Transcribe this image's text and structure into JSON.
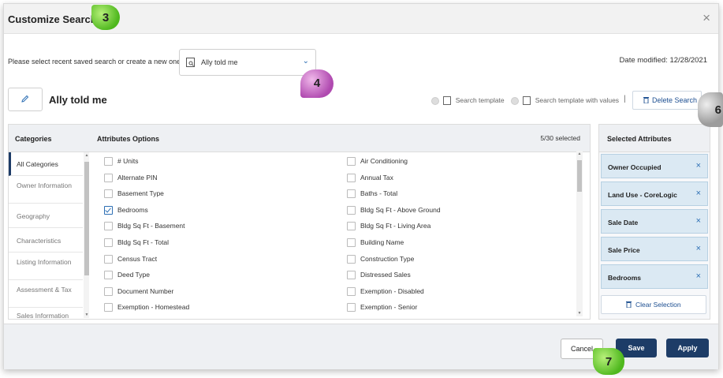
{
  "dialog": {
    "title": "Customize Search",
    "close_glyph": "×"
  },
  "search_select": {
    "prompt": "Please select recent saved search or create a new one:",
    "selected": "Ally told me",
    "date_modified_label": "Date modified:",
    "date_modified_value": "12/28/2021"
  },
  "current_search": {
    "name": "Ally told me",
    "option_template": "Search template",
    "option_template_values": "Search template with values",
    "separator": "|",
    "delete_label": "Delete Search"
  },
  "categories": {
    "header": "Categories",
    "items": [
      "All Categories",
      "Owner Information",
      "Geography",
      "Characteristics",
      "Listing Information",
      "Assessment & Tax",
      "Sales Information"
    ]
  },
  "attributes": {
    "header": "Attributes Options",
    "count": "5/30 selected",
    "left": [
      {
        "label": "# Units",
        "checked": false
      },
      {
        "label": "Alternate PIN",
        "checked": false
      },
      {
        "label": "Basement Type",
        "checked": false
      },
      {
        "label": "Bedrooms",
        "checked": true
      },
      {
        "label": "Bldg Sq Ft - Basement",
        "checked": false
      },
      {
        "label": "Bldg Sq Ft - Total",
        "checked": false
      },
      {
        "label": "Census Tract",
        "checked": false
      },
      {
        "label": "Deed Type",
        "checked": false
      },
      {
        "label": "Document Number",
        "checked": false
      },
      {
        "label": "Exemption - Homestead",
        "checked": false
      }
    ],
    "right": [
      {
        "label": "Air Conditioning",
        "checked": false
      },
      {
        "label": "Annual Tax",
        "checked": false
      },
      {
        "label": "Baths - Total",
        "checked": false
      },
      {
        "label": "Bldg Sq Ft - Above Ground",
        "checked": false
      },
      {
        "label": "Bldg Sq Ft - Living Area",
        "checked": false
      },
      {
        "label": "Building Name",
        "checked": false
      },
      {
        "label": "Construction Type",
        "checked": false
      },
      {
        "label": "Distressed Sales",
        "checked": false
      },
      {
        "label": "Exemption - Disabled",
        "checked": false
      },
      {
        "label": "Exemption - Senior",
        "checked": false
      }
    ]
  },
  "selected": {
    "header": "Selected Attributes",
    "items": [
      "Owner Occupied",
      "Land Use - CoreLogic",
      "Sale Date",
      "Sale Price",
      "Bedrooms"
    ],
    "remove_glyph": "×",
    "clear_label": "Clear Selection"
  },
  "footer": {
    "cancel": "Cancel",
    "save": "Save",
    "apply": "Apply"
  },
  "callouts": [
    "3",
    "4",
    "6",
    "7"
  ],
  "colors": {
    "primary": "#1d3c67",
    "link": "#2d6fb4",
    "selected_bg": "#dbe9f3"
  },
  "icons": [
    "close-icon",
    "search-template-icon",
    "chevron-down-icon",
    "pencil-icon",
    "trash-icon",
    "remove-icon",
    "checkbox-icon"
  ]
}
